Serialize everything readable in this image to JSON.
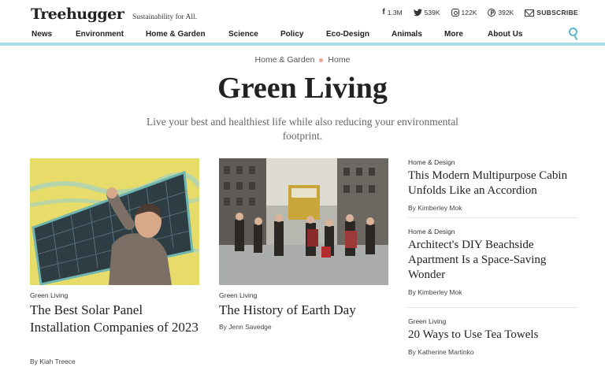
{
  "header": {
    "logo": "Treehugger",
    "tagline": "Sustainability for All.",
    "social": [
      {
        "icon": "facebook-icon",
        "glyph": "f",
        "count": "1.3M"
      },
      {
        "icon": "twitter-icon",
        "glyph": "🐦",
        "count": "539K"
      },
      {
        "icon": "instagram-icon",
        "glyph": "",
        "count": "122K"
      },
      {
        "icon": "pinterest-icon",
        "glyph": "℗",
        "count": "392K"
      }
    ],
    "subscribe": "SUBSCRIBE"
  },
  "nav": {
    "items": [
      "News",
      "Environment",
      "Home & Garden",
      "Science",
      "Policy",
      "Eco-Design",
      "Animals",
      "More",
      "About Us"
    ],
    "search_icon": "search-icon",
    "rule_color": "#a8dbe6"
  },
  "hero": {
    "breadcrumb": [
      "Home & Garden",
      "Home"
    ],
    "title": "Green Living",
    "description": "Live your best and healthiest life while also reducing your environmental footprint."
  },
  "featured": [
    {
      "category": "Green Living",
      "title": "The Best Solar Panel Installation Companies of 2023",
      "byline": "By Kiah Treece"
    },
    {
      "category": "Green Living",
      "title": "The History of Earth Day",
      "byline": "By Jenn Savedge"
    }
  ],
  "sidebar_articles": [
    {
      "category": "Home & Design",
      "title": "This Modern Multipurpose Cabin Unfolds Like an Accordion",
      "byline": "By Kimberley Mok"
    },
    {
      "category": "Home & Design",
      "title": "Architect's DIY Beachside Apartment Is a Space-Saving Wonder",
      "byline": "By Kimberley Mok"
    },
    {
      "category": "Green Living",
      "title": "20 Ways to Use Tea Towels",
      "byline": "By Katherine Martinko"
    }
  ]
}
